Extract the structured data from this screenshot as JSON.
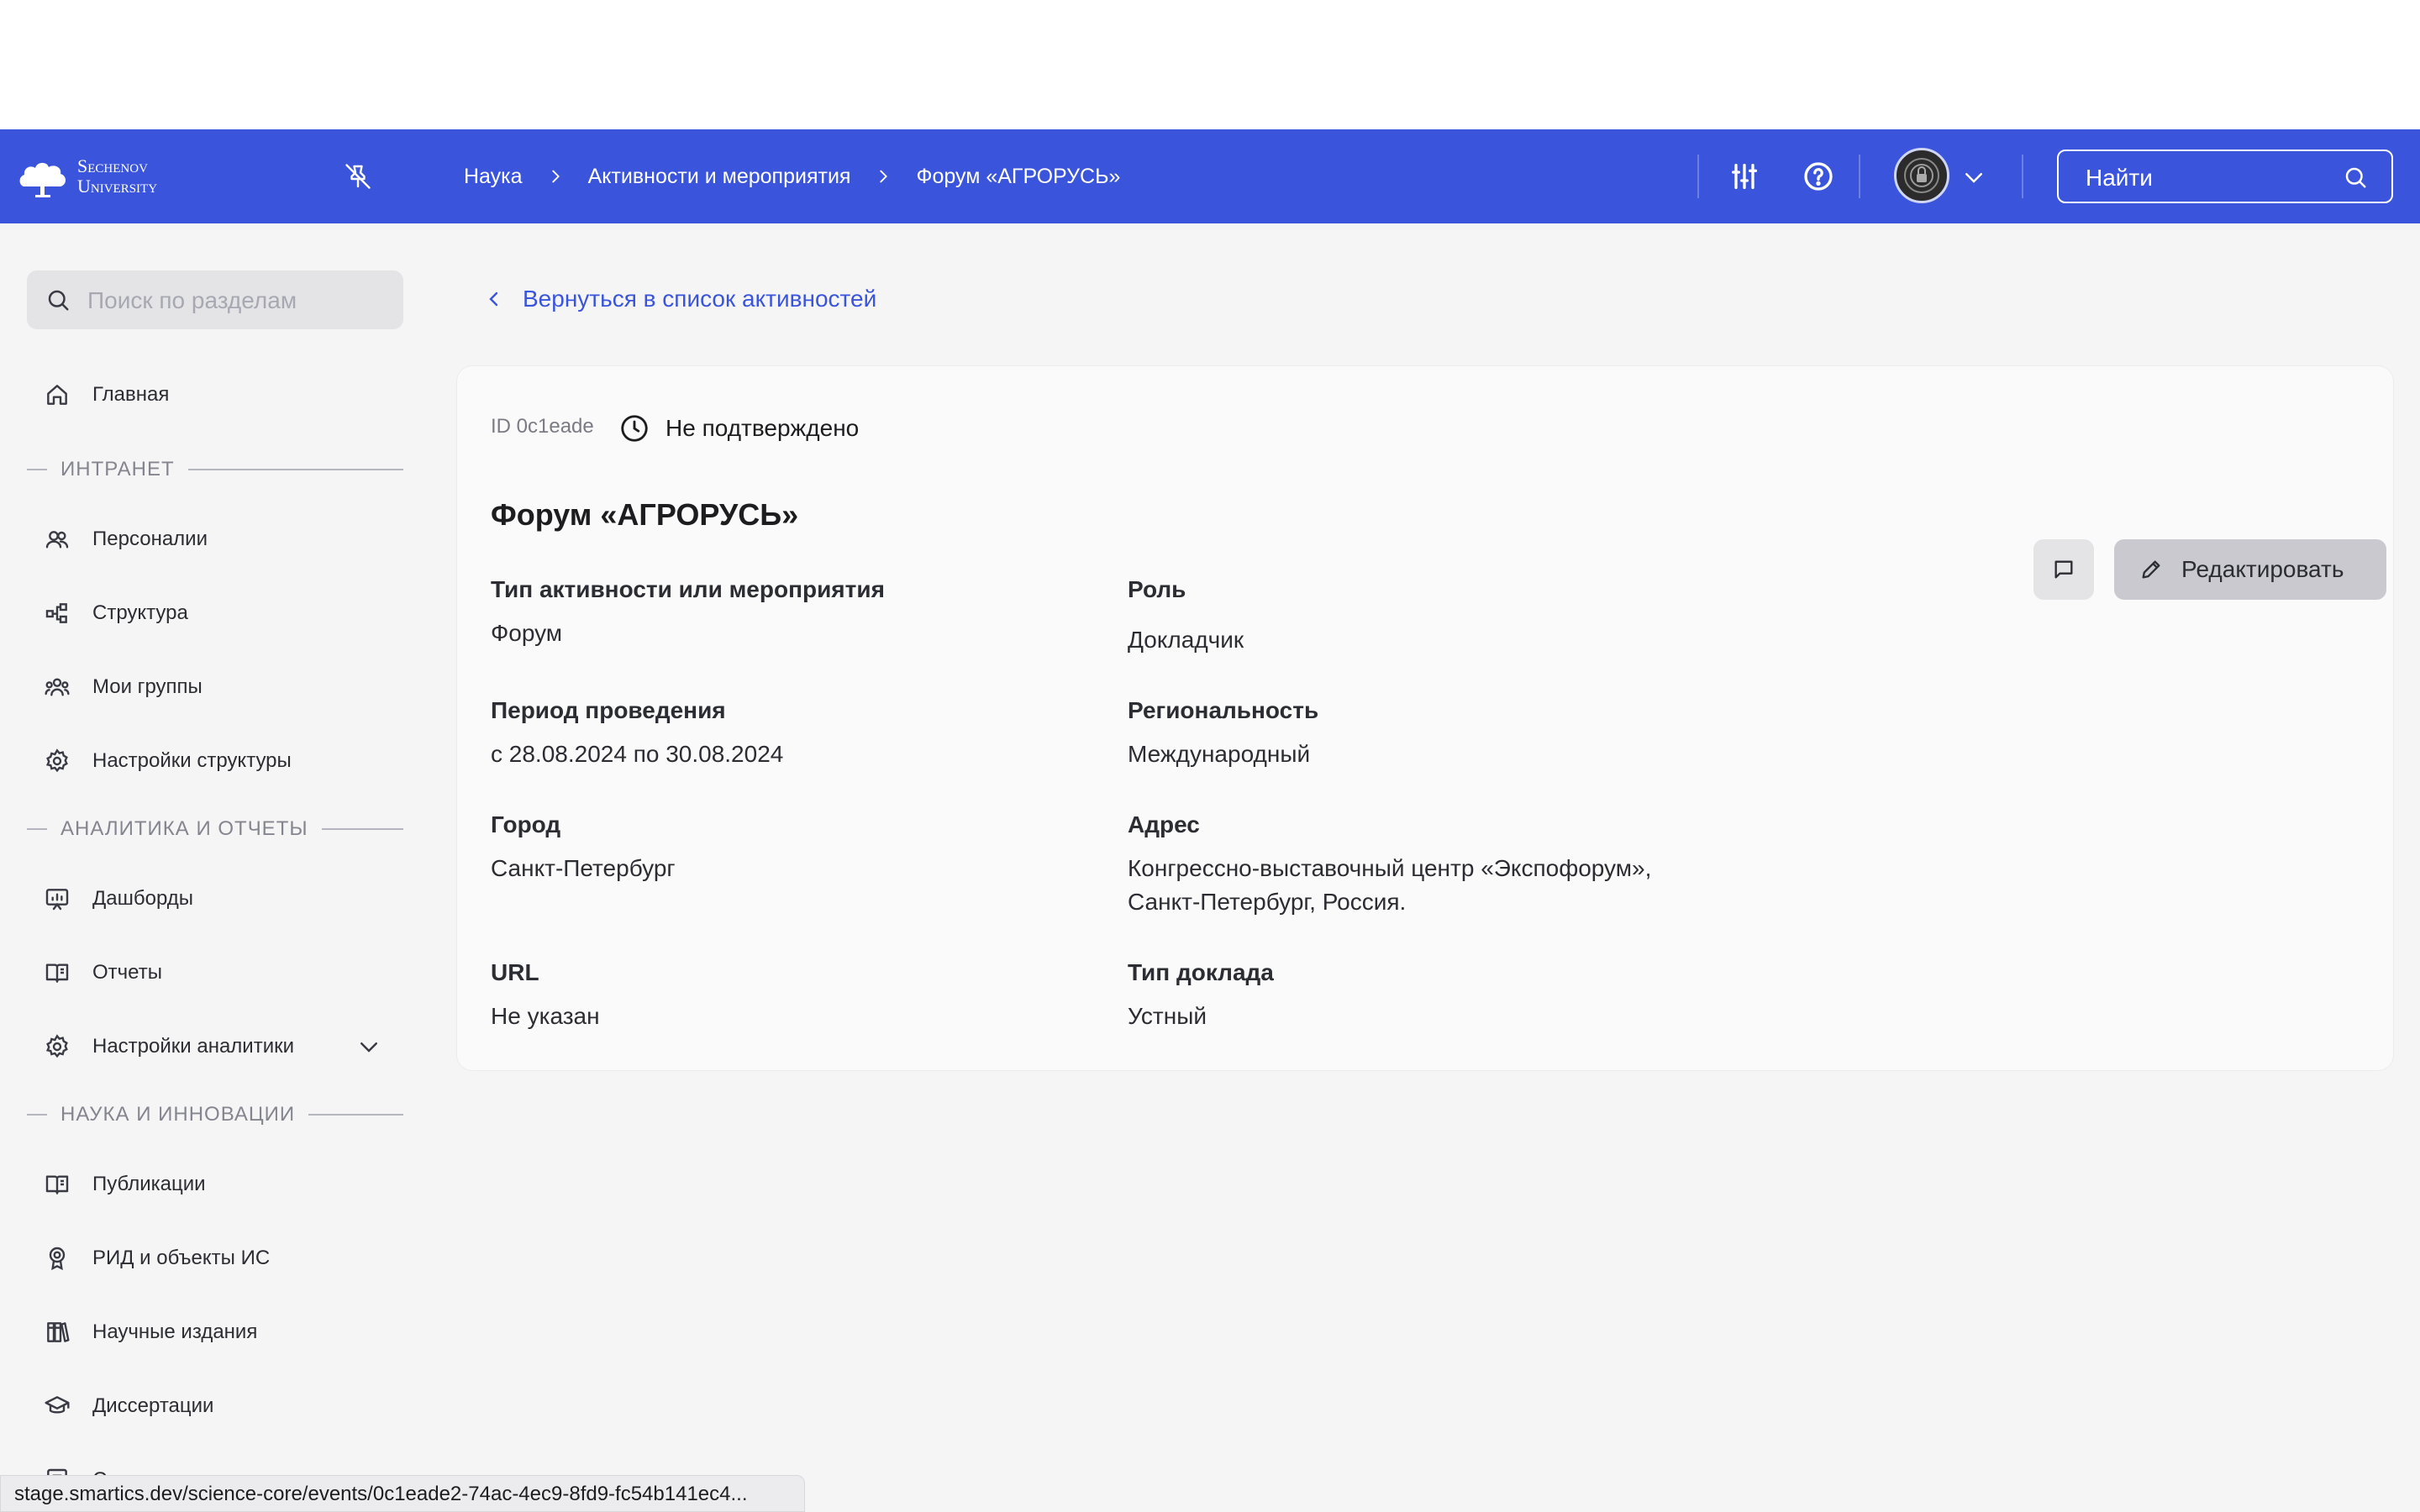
{
  "header": {
    "logo_line1": "Sechenov",
    "logo_line2": "University",
    "breadcrumbs": [
      "Наука",
      "Активности и мероприятия",
      "Форум «АГРОРУСЬ»"
    ],
    "search_placeholder": "Найти"
  },
  "sidebar": {
    "search_placeholder": "Поиск по разделам",
    "home": "Главная",
    "sections": {
      "intranet": "ИНТРАНЕТ",
      "analytics": "АНАЛИТИКА И ОТЧЕТЫ",
      "science": "НАУКА И ИННОВАЦИИ"
    },
    "items": {
      "personalii": "Персоналии",
      "structure": "Структура",
      "my_groups": "Мои группы",
      "structure_settings": "Настройки структуры",
      "dashboards": "Дашборды",
      "reports": "Отчеты",
      "analytics_settings": "Настройки аналитики",
      "publications": "Публикации",
      "rid": "РИД и объекты ИС",
      "journals": "Научные издания",
      "dissertations": "Диссертации",
      "lit_lists": "Списки литературы"
    }
  },
  "main": {
    "back_link": "Вернуться в список активностей",
    "id_label": "ID 0c1eade",
    "status": "Не подтверждено",
    "edit_button": "Редактировать",
    "title": "Форум «АГРОРУСЬ»",
    "fields": {
      "activity_type": {
        "label": "Тип активности или мероприятия",
        "value": "Форум"
      },
      "role": {
        "label": "Роль",
        "value": "Докладчик"
      },
      "period": {
        "label": "Период проведения",
        "value": "с 28.08.2024 по 30.08.2024"
      },
      "regionality": {
        "label": "Региональность",
        "value": "Международный"
      },
      "city": {
        "label": "Город",
        "value": "Санкт-Петербург"
      },
      "address": {
        "label": "Адрес",
        "value_line1": "Конгрессно-выставочный центр «Экспофорум»,",
        "value_line2": "Санкт-Петербург, Россия."
      },
      "url": {
        "label": "URL",
        "value": "Не указан"
      },
      "report_type": {
        "label": "Тип доклада",
        "value": "Устный"
      }
    }
  },
  "statusbar": {
    "url": "stage.smartics.dev/science-core/events/0c1eade2-74ac-4ec9-8fd9-fc54b141ec4..."
  },
  "colors": {
    "header_bg": "#3a55db",
    "link": "#3a55db",
    "page_bg": "#f5f5f6"
  },
  "icons": [
    "university-logo-icon",
    "unpin-icon",
    "chevron-right-icon",
    "filters-icon",
    "help-icon",
    "avatar",
    "chevron-down-icon",
    "search-icon",
    "home-icon",
    "people-icon",
    "structure-icon",
    "groups-icon",
    "gear-icon",
    "dashboard-icon",
    "book-icon",
    "award-icon",
    "journals-icon",
    "graduation-cap-icon",
    "chevron-left-icon",
    "clock-icon",
    "comment-icon",
    "pencil-icon"
  ]
}
